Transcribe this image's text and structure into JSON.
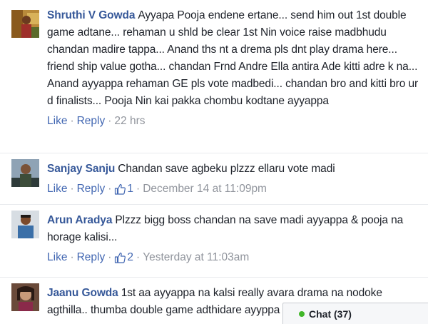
{
  "comments": [
    {
      "author": "Shruthi V Gowda",
      "text": "Ayyapa Pooja endene ertane... send him out 1st double game adtane... rehaman u shld be clear 1st Nin voice raise madbhudu chandan madire tappa... Anand ths nt a drema pls dnt play drama here... friend ship value gotha... chandan Frnd Andre Ella antira Ade kitti adre k na... Anand ayyappa rehaman GE pls vote madbedi... chandan bro and kitti bro ur d finalists... Pooja Nin kai pakka chombu kodtane ayyappa",
      "like_label": "Like",
      "reply_label": "Reply",
      "likes": "",
      "time": "22 hrs"
    },
    {
      "author": "Sanjay Sanju",
      "text": "Chandan save agbeku plzzz ellaru vote madi",
      "like_label": "Like",
      "reply_label": "Reply",
      "likes": "1",
      "time": "December 14 at 11:09pm"
    },
    {
      "author": "Arun Aradya",
      "text": "Plzzz bigg boss chandan na save madi ayyappa & pooja na horage kalisi...",
      "like_label": "Like",
      "reply_label": "Reply",
      "likes": "2",
      "time": "Yesterday at 11:03am"
    },
    {
      "author": "Jaanu Gowda",
      "text": "1st aa ayyappa na kalsi really avara drama na nodoke agthilla.. thumba double game adthidare ayyppa and pooja",
      "like_label": "",
      "reply_label": "",
      "likes": "",
      "time": ""
    }
  ],
  "separator": "·",
  "chat": {
    "label": "Chat (37)",
    "status_color": "#42b72a"
  },
  "colors": {
    "author": "#365899",
    "link": "#4267b2",
    "meta": "#90949c",
    "text": "#1d2129"
  },
  "icons": {
    "like_count": "thumbs-up-icon",
    "chat_status": "online-dot-icon"
  }
}
